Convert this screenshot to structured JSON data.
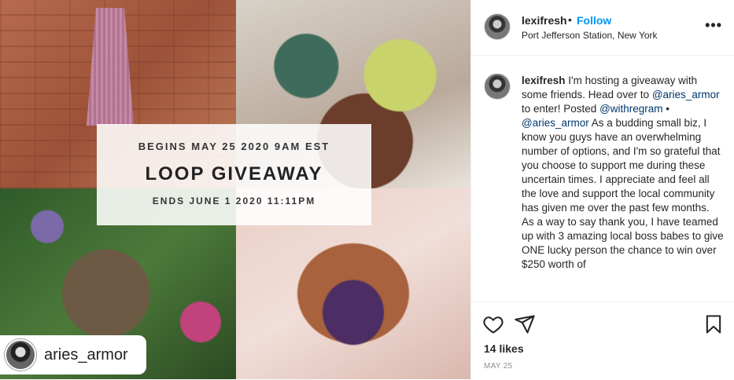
{
  "post": {
    "image": {
      "banner": {
        "line1": "BEGINS MAY 25 2020 9AM EST",
        "title": "LOOP GIVEAWAY",
        "line3": "ENDS JUNE 1 2020 11:11PM"
      },
      "tag_username": "aries_armor"
    },
    "header": {
      "username": "lexifresh",
      "separator": "•",
      "follow_label": "Follow",
      "location": "Port Jefferson Station, New York",
      "more_label": "•••"
    },
    "caption": {
      "username": "lexifresh",
      "t1": " I'm hosting a giveaway with some friends. Head over to ",
      "m1": "@aries_armor",
      "t2": " to enter! Posted ",
      "m2": "@withregram",
      "t3": " • ",
      "m3": "@aries_armor",
      "t4": " As a budding small biz, I know you guys have an overwhelming number of options, and I'm so grateful that you choose to support me during these uncertain times. I appreciate and feel all the love and support the local community has given me over the past few months.",
      "t5": "As a way to say thank you, I have teamed up with 3 amazing local boss babes to give ONE lucky person the chance to win over $250 worth of"
    },
    "actions": {
      "icons": [
        "heart-icon",
        "share-icon",
        "bookmark-icon"
      ],
      "likes": "14 likes",
      "date": "MAY 25"
    }
  }
}
